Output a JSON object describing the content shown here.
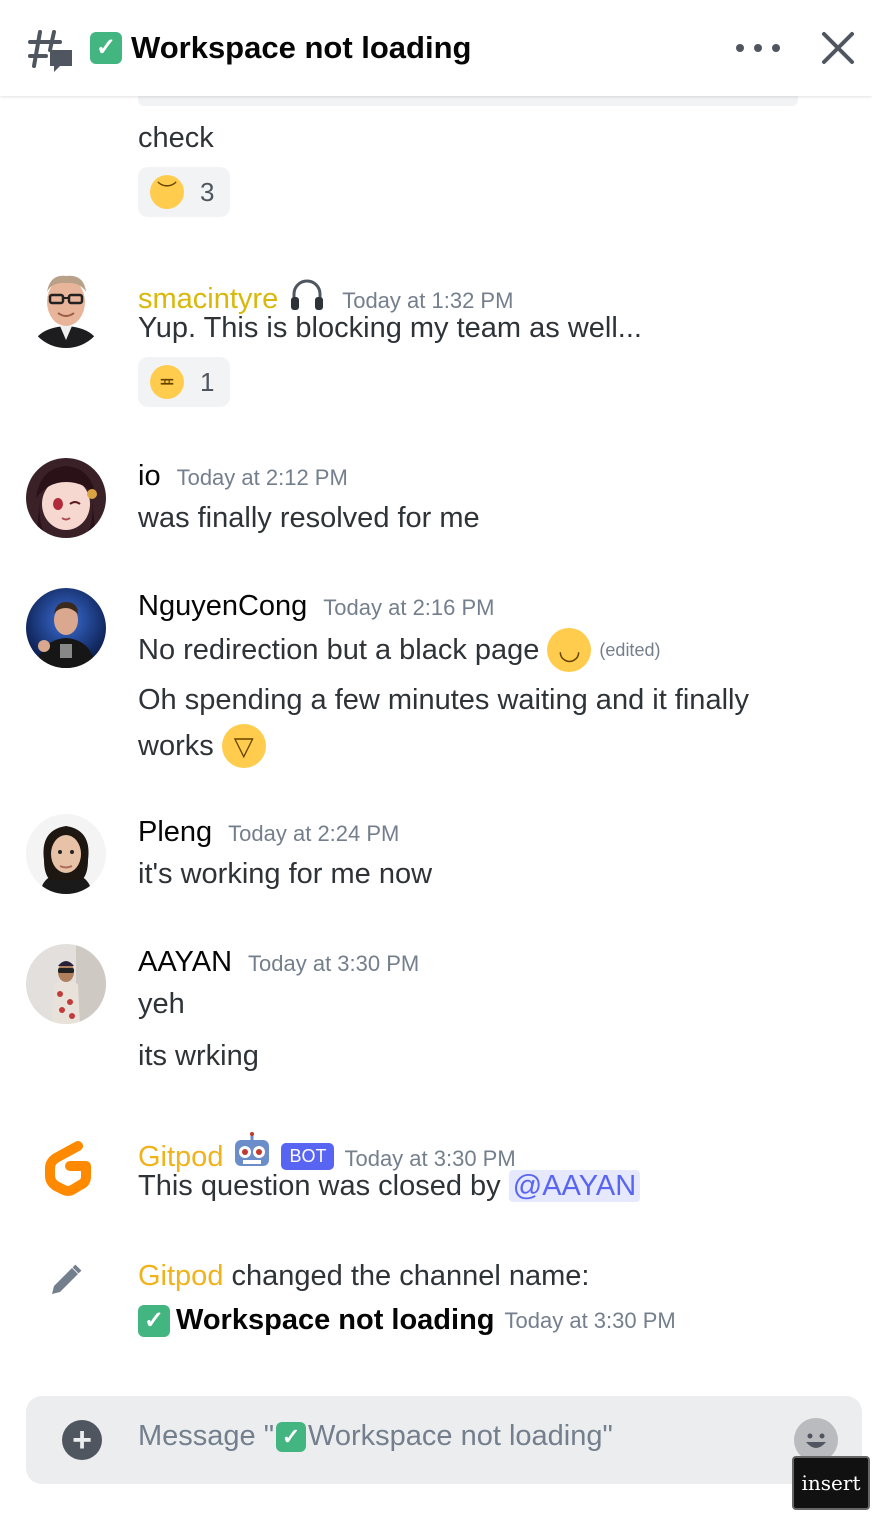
{
  "header": {
    "title": "Workspace not loading"
  },
  "messages": {
    "m0": {
      "text": "check",
      "reaction_count": "3"
    },
    "m1": {
      "author": "smacintyre",
      "time": "Today at 1:32 PM",
      "text": "Yup. This is blocking my team as well...",
      "reaction_count": "1"
    },
    "m2": {
      "author": "io",
      "time": "Today at 2:12 PM",
      "text": "was finally resolved for me"
    },
    "m3": {
      "author": "NguyenCong",
      "time": "Today at 2:16 PM",
      "text1": "No redirection but a black page",
      "edited": "(edited)",
      "text2a": "Oh spending a few minutes waiting and it finally",
      "text2b": "works"
    },
    "m4": {
      "author": "Pleng",
      "time": "Today at 2:24 PM",
      "text": "it's working for me now"
    },
    "m5": {
      "author": "AAYAN",
      "time": "Today at 3:30 PM",
      "text1": "yeh",
      "text2": "its wrking"
    },
    "m6": {
      "author": "Gitpod",
      "badge": "BOT",
      "time": "Today at 3:30 PM",
      "text": "This question was closed by",
      "mention": "@AAYAN"
    },
    "m7": {
      "author": "Gitpod",
      "action": "changed the channel name:",
      "new_name": "Workspace not loading",
      "time": "Today at 3:30 PM"
    }
  },
  "composer": {
    "placeholder_prefix": "Message \"",
    "placeholder_name": "Workspace not loading",
    "placeholder_suffix": "\""
  },
  "tooltip": {
    "insert": "insert"
  },
  "colors": {
    "accent": "#5865f2",
    "username_yellow": "#d9b80b",
    "check_green": "#43b581"
  }
}
